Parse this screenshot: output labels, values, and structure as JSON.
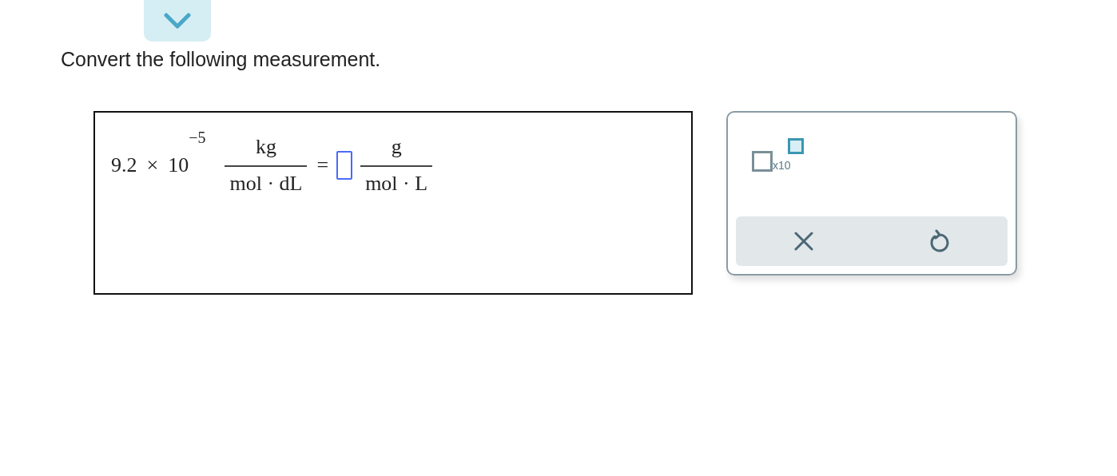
{
  "prompt": "Convert the following measurement.",
  "expression": {
    "mantissa": "9.2",
    "times": "×",
    "base": "10",
    "exponent": "−5",
    "from_unit": {
      "numerator": "kg",
      "denominator": "mol · dL"
    },
    "equals": "=",
    "to_unit": {
      "numerator": "g",
      "denominator": "mol · L"
    }
  },
  "toolbar": {
    "tools": [
      {
        "kind": "sci_notation",
        "label": "x10"
      }
    ],
    "actions": [
      {
        "kind": "clear"
      },
      {
        "kind": "undo"
      }
    ]
  }
}
